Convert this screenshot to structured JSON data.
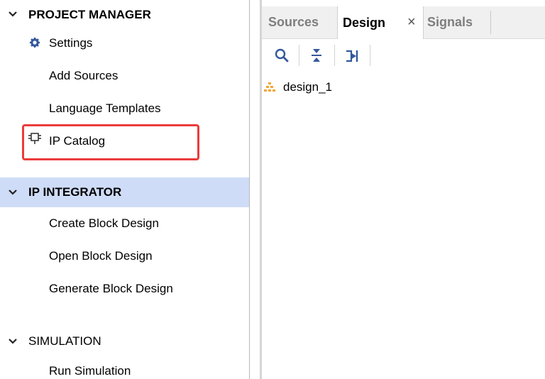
{
  "navigator": {
    "project_manager": {
      "title": "PROJECT MANAGER",
      "items": [
        {
          "label": "Settings",
          "icon": "gear-icon"
        },
        {
          "label": "Add Sources"
        },
        {
          "label": "Language Templates"
        },
        {
          "label": "IP Catalog",
          "icon": "ip-catalog-icon"
        }
      ]
    },
    "ip_integrator": {
      "title": "IP INTEGRATOR",
      "items": [
        {
          "label": "Create Block Design"
        },
        {
          "label": "Open Block Design"
        },
        {
          "label": "Generate Block Design"
        }
      ]
    },
    "simulation": {
      "title": "SIMULATION",
      "items": [
        {
          "label": "Run Simulation"
        }
      ]
    }
  },
  "panel": {
    "tabs": [
      {
        "label": "Sources"
      },
      {
        "label": "Design",
        "close": "×"
      },
      {
        "label": "Signals"
      }
    ],
    "toolbar": [
      "search-icon",
      "collapse-all-icon",
      "expand-icon"
    ],
    "tree": [
      {
        "label": "design_1",
        "icon": "block-design-icon"
      }
    ]
  },
  "colors": {
    "selection_bg": "#cfdcf7",
    "highlight_border": "#ec3b3b",
    "icon_blue": "#34589c",
    "design_icon": "#f2a532"
  }
}
